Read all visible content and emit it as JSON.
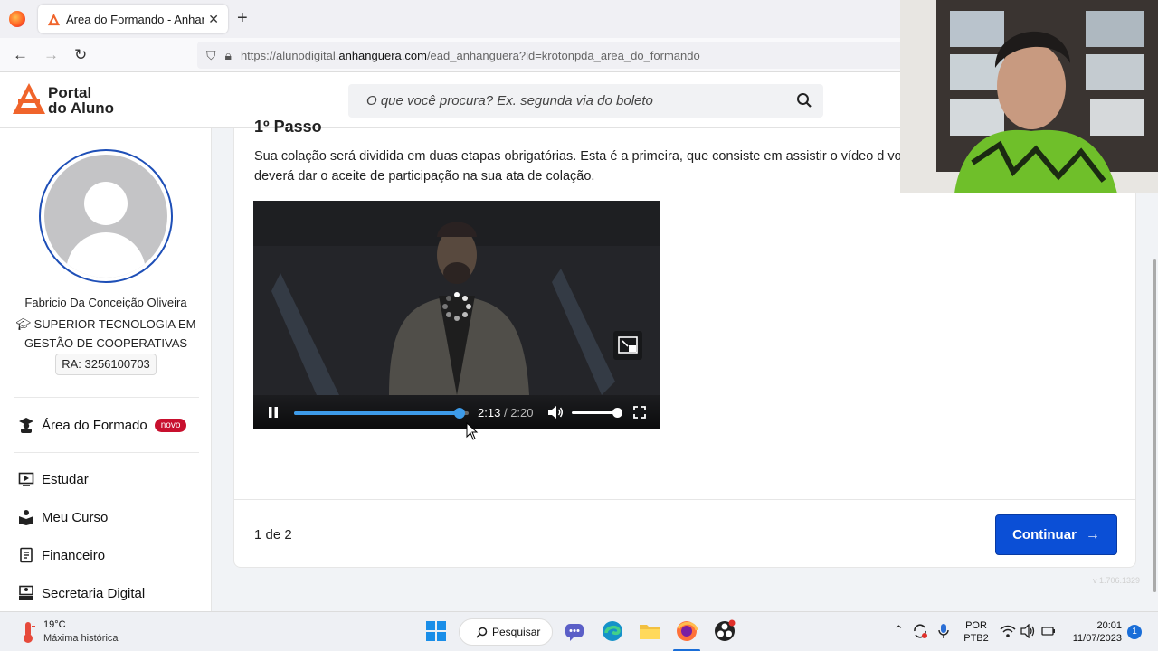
{
  "browser": {
    "tab_title": "Área do Formando - Anhanguera",
    "url_prefix": "https://alunodigital.",
    "url_domain": "anhanguera.com",
    "url_suffix": "/ead_anhanguera?id=krotonpda_area_do_formando"
  },
  "header": {
    "logo_line1": "Portal",
    "logo_line2": "do Aluno",
    "search_placeholder": "O que você procura? Ex. segunda via do boleto"
  },
  "profile": {
    "name": "Fabricio Da Conceição Oliveira",
    "course": "SUPERIOR TECNOLOGIA EM GESTÃO DE COOPERATIVAS",
    "ra": "RA: 3256100703"
  },
  "menu": {
    "formado_label": "Área do Formado",
    "formado_badge": "novo",
    "items": [
      "Estudar",
      "Meu Curso",
      "Financeiro",
      "Secretaria Digital"
    ]
  },
  "content": {
    "step_heading": "1º Passo",
    "intro": "Sua colação será dividida em duas etapas obrigatórias. Esta é a primeira, que consiste em assistir o vídeo d você deverá dar o aceite de participação na sua ata de colação."
  },
  "video": {
    "current_time": "2:13",
    "separator": "/",
    "duration": "2:20",
    "progress_fraction": 0.95,
    "volume_fraction": 1.0,
    "accent_color": "#3d9be9"
  },
  "footer": {
    "pager": "1 de 2",
    "continue_label": "Continuar"
  },
  "version_text": "v 1.706.1329",
  "taskbar": {
    "temperature": "19°C",
    "weather_desc": "Máxima histórica",
    "search_label": "Pesquisar",
    "lang_line1": "POR",
    "lang_line2": "PTB2",
    "time": "20:01",
    "date": "11/07/2023",
    "notifications": "1"
  },
  "colors": {
    "primary_button": "#0b4fd6",
    "badge": "#c8102e",
    "avatar_ring": "#1e4fb7"
  }
}
